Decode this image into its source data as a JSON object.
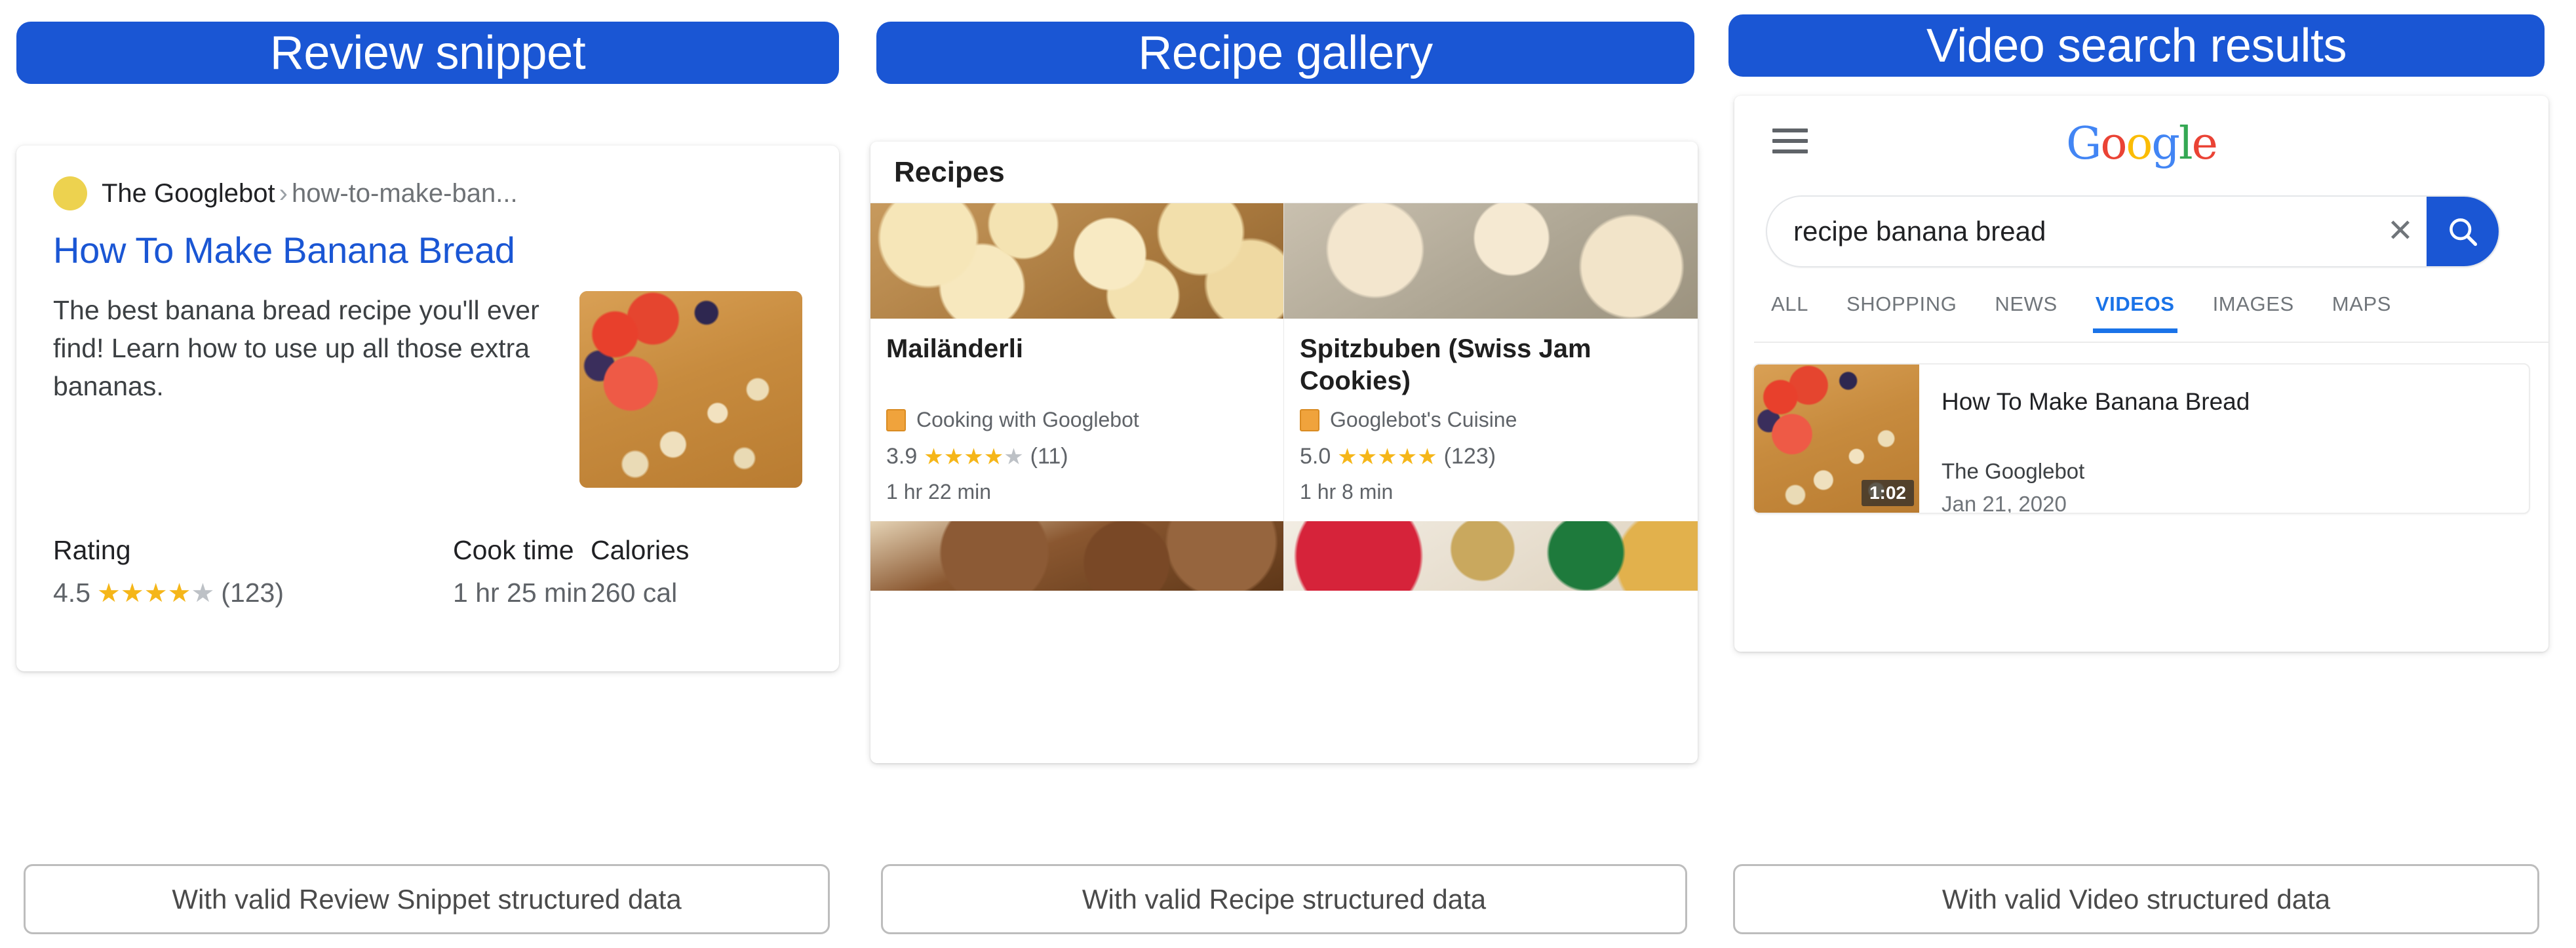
{
  "columns": [
    {
      "header": "Review snippet",
      "caption": "With valid Review Snippet structured data"
    },
    {
      "header": "Recipe gallery",
      "caption": "With valid Recipe structured data"
    },
    {
      "header": "Video search results",
      "caption": "With valid Video structured data"
    }
  ],
  "review_snippet": {
    "site_name": "The Googlebot",
    "breadcrumb_separator": "›",
    "breadcrumb_path": "how-to-make-ban...",
    "title": "How To Make Banana Bread",
    "snippet": "The best banana bread recipe you'll ever find! Learn how to use up all those extra bananas.",
    "facts": [
      {
        "label": "Rating",
        "value": "4.5",
        "stars_full": 4,
        "stars_half": 1,
        "stars_empty": 0,
        "count": "(123)"
      },
      {
        "label": "Cook time",
        "value": "1 hr 25 min"
      },
      {
        "label": "Calories",
        "value": "260 cal"
      }
    ]
  },
  "recipe_gallery": {
    "heading": "Recipes",
    "cards": [
      {
        "title": "Mailänderli",
        "site": "Cooking with Googlebot",
        "rating": "3.9",
        "stars_full": 4,
        "stars_empty": 1,
        "count": "(11)",
        "time": "1 hr 22 min"
      },
      {
        "title": "Spitzbuben (Swiss Jam Cookies)",
        "site": "Googlebot's Cuisine",
        "rating": "5.0",
        "stars_full": 5,
        "stars_empty": 0,
        "count": "(123)",
        "time": "1 hr 8 min"
      }
    ]
  },
  "video_search": {
    "logo": {
      "g1": "G",
      "o1": "o",
      "o2": "o",
      "g2": "g",
      "l": "l",
      "e": "e"
    },
    "search": {
      "query": "recipe banana bread",
      "placeholder": "Search",
      "clear_label": "✕"
    },
    "tabs": [
      {
        "label": "ALL",
        "active": false
      },
      {
        "label": "SHOPPING",
        "active": false
      },
      {
        "label": "NEWS",
        "active": false
      },
      {
        "label": "VIDEOS",
        "active": true
      },
      {
        "label": "IMAGES",
        "active": false
      },
      {
        "label": "MAPS",
        "active": false
      }
    ],
    "result": {
      "title": "How To Make Banana Bread",
      "channel": "The Googlebot",
      "date": "Jan 21, 2020",
      "duration": "1:02"
    }
  },
  "colors": {
    "accent_blue": "#1A56D4",
    "tab_blue": "#1A73E8",
    "star_gold": "#F5B619",
    "star_grey": "#BDC1C6",
    "favicon_yellow": "#EDD24F",
    "site_chip_orange": "#F0A33C",
    "caption_border": "#BDBDBD"
  }
}
